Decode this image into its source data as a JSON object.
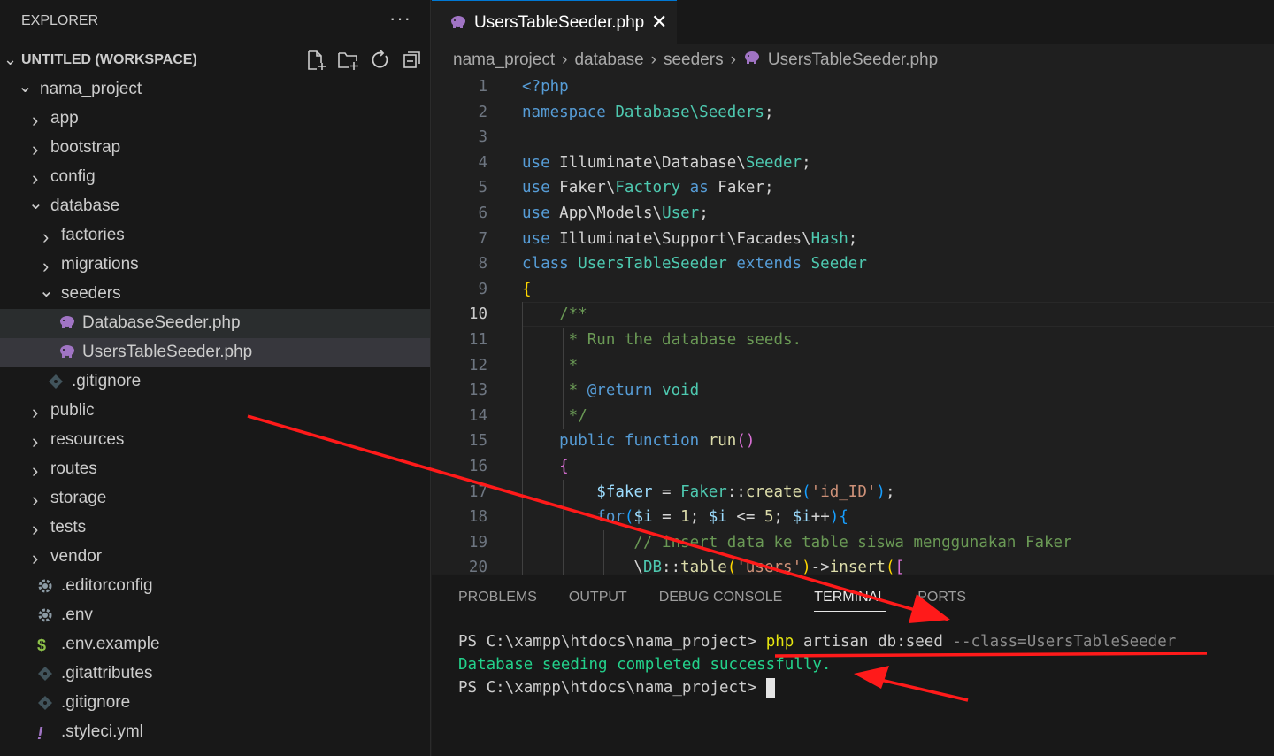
{
  "explorer": {
    "title": "EXPLORER",
    "more": "···"
  },
  "workspace": {
    "title": "UNTITLED (WORKSPACE)"
  },
  "tree": [
    {
      "label": "nama_project",
      "chev": "v",
      "indent": 0
    },
    {
      "label": "app",
      "chev": ">",
      "indent": 1
    },
    {
      "label": "bootstrap",
      "chev": ">",
      "indent": 1
    },
    {
      "label": "config",
      "chev": ">",
      "indent": 1
    },
    {
      "label": "database",
      "chev": "v",
      "indent": 1
    },
    {
      "label": "factories",
      "chev": ">",
      "indent": 2
    },
    {
      "label": "migrations",
      "chev": ">",
      "indent": 2
    },
    {
      "label": "seeders",
      "chev": "v",
      "indent": 2
    },
    {
      "label": "DatabaseSeeder.php",
      "icon": "php",
      "indent": 3,
      "hl": "hl1"
    },
    {
      "label": "UsersTableSeeder.php",
      "icon": "php",
      "indent": 3,
      "hl": "hl2"
    },
    {
      "label": ".gitignore",
      "icon": "git",
      "indent": 2
    },
    {
      "label": "public",
      "chev": ">",
      "indent": 1
    },
    {
      "label": "resources",
      "chev": ">",
      "indent": 1
    },
    {
      "label": "routes",
      "chev": ">",
      "indent": 1
    },
    {
      "label": "storage",
      "chev": ">",
      "indent": 1
    },
    {
      "label": "tests",
      "chev": ">",
      "indent": 1
    },
    {
      "label": "vendor",
      "chev": ">",
      "indent": 1
    },
    {
      "label": ".editorconfig",
      "icon": "gear",
      "indent": 1
    },
    {
      "label": ".env",
      "icon": "gear",
      "indent": 1
    },
    {
      "label": ".env.example",
      "icon": "dollar",
      "indent": 1
    },
    {
      "label": ".gitattributes",
      "icon": "git",
      "indent": 1
    },
    {
      "label": ".gitignore",
      "icon": "git",
      "indent": 1
    },
    {
      "label": ".styleci.yml",
      "icon": "exclaim",
      "indent": 1
    }
  ],
  "tab": {
    "label": "UsersTableSeeder.php",
    "close": "✕"
  },
  "breadcrumb": [
    "nama_project",
    "database",
    "seeders",
    "UsersTableSeeder.php"
  ],
  "code": {
    "active_line": 10,
    "lines": [
      [
        [
          "<?php",
          "kw"
        ]
      ],
      [
        [
          "namespace ",
          "kw"
        ],
        [
          "Database\\Seeders",
          "ty"
        ],
        [
          ";",
          "pl"
        ]
      ],
      [],
      [
        [
          "use ",
          "kw"
        ],
        [
          "Illuminate\\Database\\",
          "pl"
        ],
        [
          "Seeder",
          "ty"
        ],
        [
          ";",
          "pl"
        ]
      ],
      [
        [
          "use ",
          "kw"
        ],
        [
          "Faker\\",
          "pl"
        ],
        [
          "Factory",
          "ty"
        ],
        [
          " as ",
          "kw"
        ],
        [
          "Faker",
          "pl"
        ],
        [
          ";",
          "pl"
        ]
      ],
      [
        [
          "use ",
          "kw"
        ],
        [
          "App\\Models\\",
          "pl"
        ],
        [
          "User",
          "ty"
        ],
        [
          ";",
          "pl"
        ]
      ],
      [
        [
          "use ",
          "kw"
        ],
        [
          "Illuminate\\Support\\Facades\\",
          "pl"
        ],
        [
          "Hash",
          "ty"
        ],
        [
          ";",
          "pl"
        ]
      ],
      [
        [
          "class ",
          "kw"
        ],
        [
          "UsersTableSeeder ",
          "ty"
        ],
        [
          "extends ",
          "kw"
        ],
        [
          "Seeder",
          "ty"
        ]
      ],
      [
        [
          "{",
          "br1"
        ]
      ],
      [
        [
          "    /**",
          "cm"
        ]
      ],
      [
        [
          "     * Run the database seeds.",
          "cm"
        ]
      ],
      [
        [
          "     *",
          "cm"
        ]
      ],
      [
        [
          "     * ",
          "cm"
        ],
        [
          "@return",
          "kw"
        ],
        [
          " ",
          "cm"
        ],
        [
          "void",
          "ty"
        ]
      ],
      [
        [
          "     */",
          "cm"
        ]
      ],
      [
        [
          "    public ",
          "kw"
        ],
        [
          "function ",
          "kw"
        ],
        [
          "run",
          "fn"
        ],
        [
          "()",
          "br2"
        ]
      ],
      [
        [
          "    ",
          "pl"
        ],
        [
          "{",
          "br2"
        ]
      ],
      [
        [
          "        ",
          "pl"
        ],
        [
          "$faker",
          "va"
        ],
        [
          " = ",
          "pl"
        ],
        [
          "Faker",
          "ty"
        ],
        [
          "::",
          "pl"
        ],
        [
          "create",
          "fn"
        ],
        [
          "(",
          "br3"
        ],
        [
          "'id_ID'",
          "st"
        ],
        [
          ")",
          "br3"
        ],
        [
          ";",
          "pl"
        ]
      ],
      [
        [
          "        ",
          "pl"
        ],
        [
          "for",
          "kw"
        ],
        [
          "(",
          "br3"
        ],
        [
          "$i",
          "va"
        ],
        [
          " = ",
          "pl"
        ],
        [
          "1",
          "fn"
        ],
        [
          "; ",
          "pl"
        ],
        [
          "$i",
          "va"
        ],
        [
          " <= ",
          "pl"
        ],
        [
          "5",
          "fn"
        ],
        [
          "; ",
          "pl"
        ],
        [
          "$i",
          "va"
        ],
        [
          "++",
          "pl"
        ],
        [
          ")",
          "br3"
        ],
        [
          "{",
          "br3"
        ]
      ],
      [
        [
          "            // insert data ke table siswa menggunakan Faker",
          "cm"
        ]
      ],
      [
        [
          "            \\",
          "pl"
        ],
        [
          "DB",
          "ty"
        ],
        [
          "::",
          "pl"
        ],
        [
          "table",
          "fn"
        ],
        [
          "(",
          "br1"
        ],
        [
          "'users'",
          "st"
        ],
        [
          ")",
          "br1"
        ],
        [
          "->",
          "pl"
        ],
        [
          "insert",
          "fn"
        ],
        [
          "(",
          "br1"
        ],
        [
          "[",
          "br2"
        ]
      ]
    ]
  },
  "panel": {
    "tabs": [
      "PROBLEMS",
      "OUTPUT",
      "DEBUG CONSOLE",
      "TERMINAL",
      "PORTS"
    ],
    "active_tab": "TERMINAL"
  },
  "terminal": {
    "prompt": "PS C:\\xampp\\htdocs\\nama_project> ",
    "cmd_php": "php",
    "cmd_rest": " artisan db:seed ",
    "cmd_flag": "--class=UsersTableSeeder",
    "output": "Database seeding completed successfully.",
    "prompt2": "PS C:\\xampp\\htdocs\\nama_project> "
  },
  "colors": {
    "accent": "#0078d4",
    "annotation": "#ff1a1a",
    "php_icon": "#a074c4"
  }
}
